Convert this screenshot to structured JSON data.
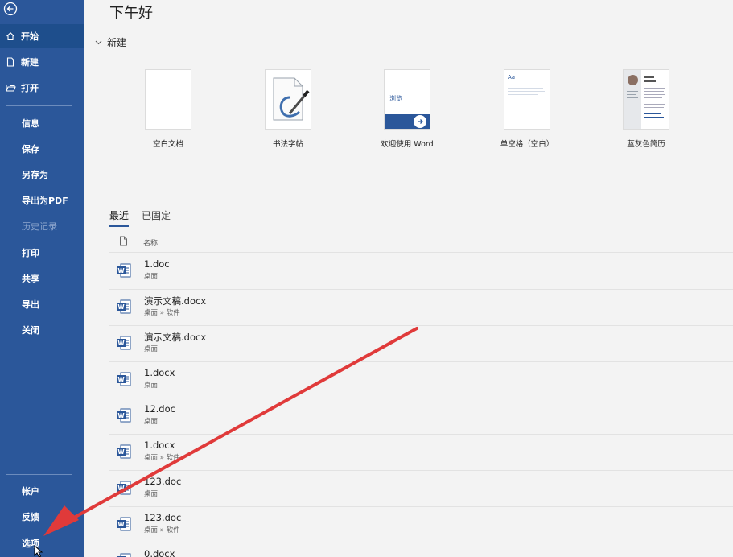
{
  "sidebar": {
    "items": [
      {
        "label": "开始"
      },
      {
        "label": "新建"
      },
      {
        "label": "打开"
      },
      {
        "label": "信息"
      },
      {
        "label": "保存"
      },
      {
        "label": "另存为"
      },
      {
        "label": "导出为PDF"
      },
      {
        "label": "历史记录"
      },
      {
        "label": "打印"
      },
      {
        "label": "共享"
      },
      {
        "label": "导出"
      },
      {
        "label": "关闭"
      },
      {
        "label": "帐户"
      },
      {
        "label": "反馈"
      },
      {
        "label": "选项"
      }
    ]
  },
  "main": {
    "greeting": "下午好",
    "new_section_label": "新建",
    "templates": [
      {
        "label": "空白文档"
      },
      {
        "label": "书法字帖"
      },
      {
        "label": "欢迎使用 Word",
        "thumb_text": "浏览"
      },
      {
        "label": "单空格（空白）",
        "thumb_text": "Aa"
      },
      {
        "label": "蓝灰色简历"
      }
    ],
    "tabs": [
      {
        "label": "最近"
      },
      {
        "label": "已固定"
      }
    ],
    "column_name": "名称",
    "files": [
      {
        "name": "1.doc",
        "path": "桌面"
      },
      {
        "name": "演示文稿.docx",
        "path": "桌面 » 软件"
      },
      {
        "name": "演示文稿.docx",
        "path": "桌面"
      },
      {
        "name": "1.docx",
        "path": "桌面"
      },
      {
        "name": "12.doc",
        "path": "桌面"
      },
      {
        "name": "1.docx",
        "path": "桌面 » 软件"
      },
      {
        "name": "123.doc",
        "path": "桌面"
      },
      {
        "name": "123.doc",
        "path": "桌面 » 软件"
      },
      {
        "name": "0.docx",
        "path": ""
      }
    ]
  },
  "colors": {
    "sidebar_bg": "#2b579a",
    "accent": "#2b579a",
    "annotation_arrow": "#e03a3a"
  }
}
